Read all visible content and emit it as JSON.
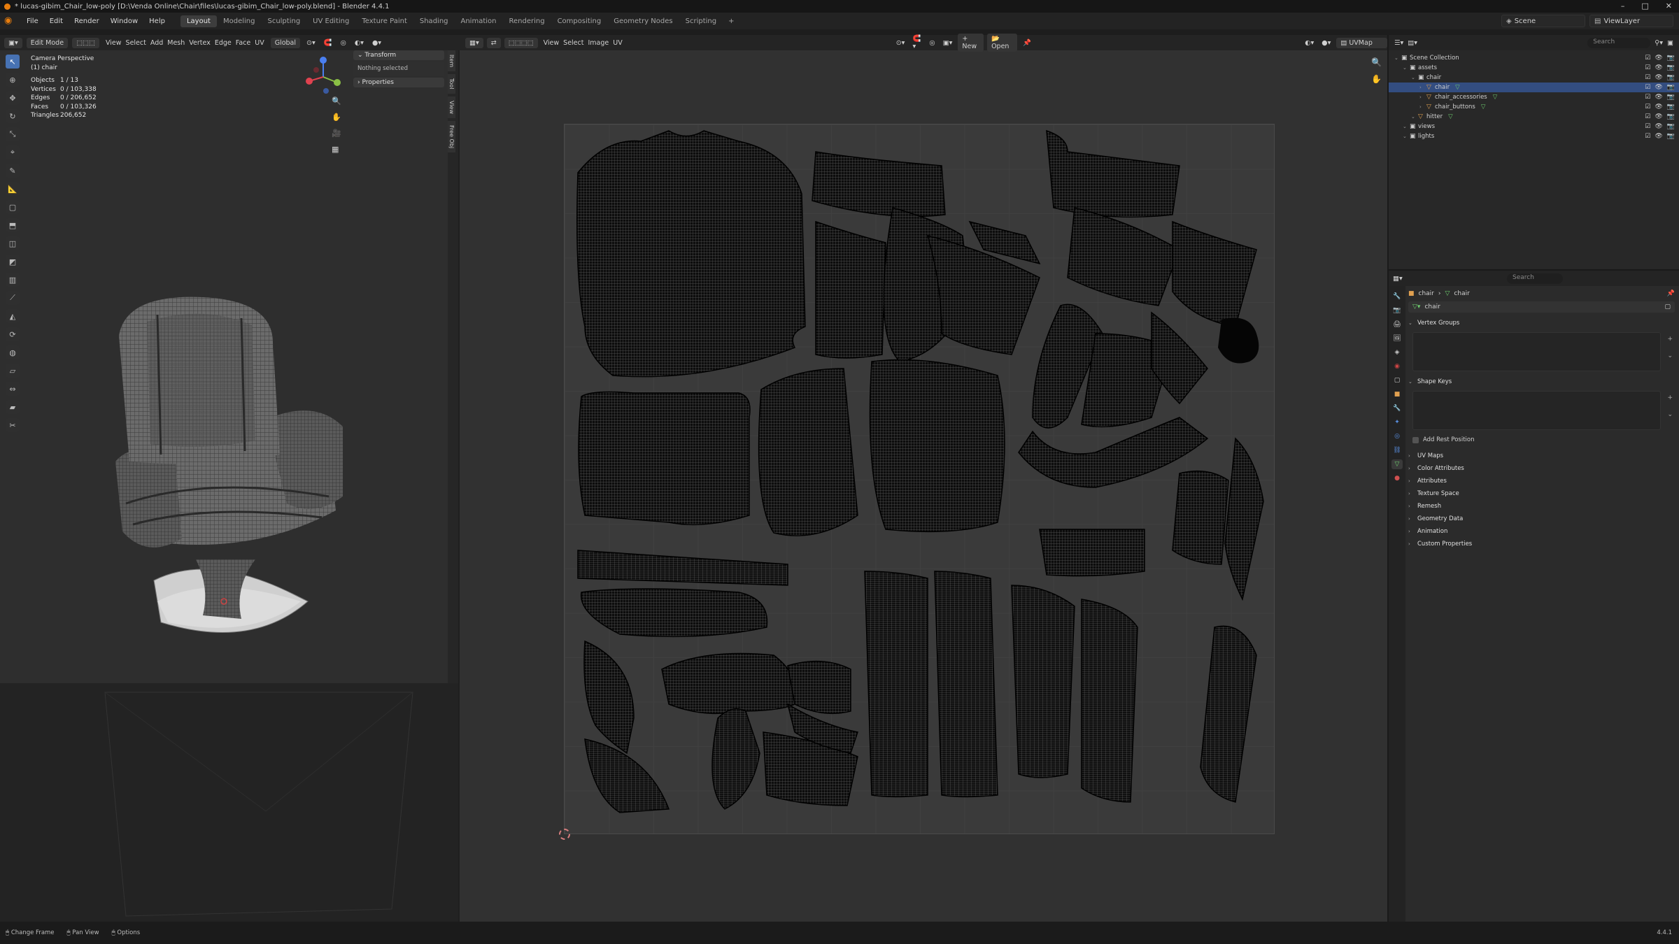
{
  "titlebar": {
    "title": "* lucas-gibim_Chair_low-poly [D:\\Venda Online\\Chair\\files\\lucas-gibim_Chair_low-poly.blend] - Blender 4.4.1"
  },
  "menu": {
    "items": [
      "File",
      "Edit",
      "Render",
      "Window",
      "Help"
    ],
    "workspaces": [
      "Layout",
      "Modeling",
      "Sculpting",
      "UV Editing",
      "Texture Paint",
      "Shading",
      "Animation",
      "Rendering",
      "Compositing",
      "Geometry Nodes",
      "Scripting"
    ],
    "active_workspace": "Layout",
    "add_tab": "+",
    "scene": "Scene",
    "view_layer": "ViewLayer"
  },
  "viewport": {
    "mode": "Edit Mode",
    "menus": [
      "View",
      "Select",
      "Add",
      "Mesh",
      "Vertex",
      "Edge",
      "Face",
      "UV"
    ],
    "transform_orientation": "Global",
    "camera_label": "Camera Perspective",
    "object_label": "(1) chair",
    "stats": [
      {
        "k": "Objects",
        "v": "1 / 13"
      },
      {
        "k": "Vertices",
        "v": "0 / 103,338"
      },
      {
        "k": "Edges",
        "v": "0 / 206,652"
      },
      {
        "k": "Faces",
        "v": "0 / 103,326"
      },
      {
        "k": "Triangles",
        "v": "206,652"
      }
    ],
    "npanel": {
      "transform": "Transform",
      "nothing_selected": "Nothing selected",
      "properties": "Properties"
    },
    "side_tabs": [
      "Item",
      "Tool",
      "View",
      "Free Obj"
    ]
  },
  "uv": {
    "menus": [
      "View",
      "Select",
      "Image",
      "UV"
    ],
    "new_label": "New",
    "open_label": "Open",
    "uvmap": "UVMap"
  },
  "outliner": {
    "search_placeholder": "Search",
    "rows": [
      {
        "label": "Scene Collection",
        "depth": 0,
        "icon": "collection"
      },
      {
        "label": "assets",
        "depth": 1,
        "icon": "collection"
      },
      {
        "label": "chair",
        "depth": 2,
        "icon": "collection"
      },
      {
        "label": "chair",
        "depth": 3,
        "icon": "mesh",
        "selected": true
      },
      {
        "label": "chair_accessories",
        "depth": 3,
        "icon": "mesh"
      },
      {
        "label": "chair_buttons",
        "depth": 3,
        "icon": "mesh"
      },
      {
        "label": "hitter",
        "depth": 2,
        "icon": "mesh"
      },
      {
        "label": "views",
        "depth": 1,
        "icon": "collection"
      },
      {
        "label": "lights",
        "depth": 1,
        "icon": "collection"
      }
    ]
  },
  "properties": {
    "search_placeholder": "Search",
    "breadcrumb": [
      "chair",
      "chair"
    ],
    "mesh_name": "chair",
    "panels": {
      "vertex_groups": "Vertex Groups",
      "shape_keys": "Shape Keys",
      "add_rest_position": "Add Rest Position",
      "collapsed": [
        "UV Maps",
        "Color Attributes",
        "Attributes",
        "Texture Space",
        "Remesh",
        "Geometry Data",
        "Animation",
        "Custom Properties"
      ]
    }
  },
  "statusbar": {
    "items": [
      "Change Frame",
      "Pan View",
      "Options"
    ],
    "version": "4.4.1"
  },
  "colors": {
    "accent": "#4772b3",
    "selection": "#334d80",
    "brand": "#e87d0d"
  }
}
